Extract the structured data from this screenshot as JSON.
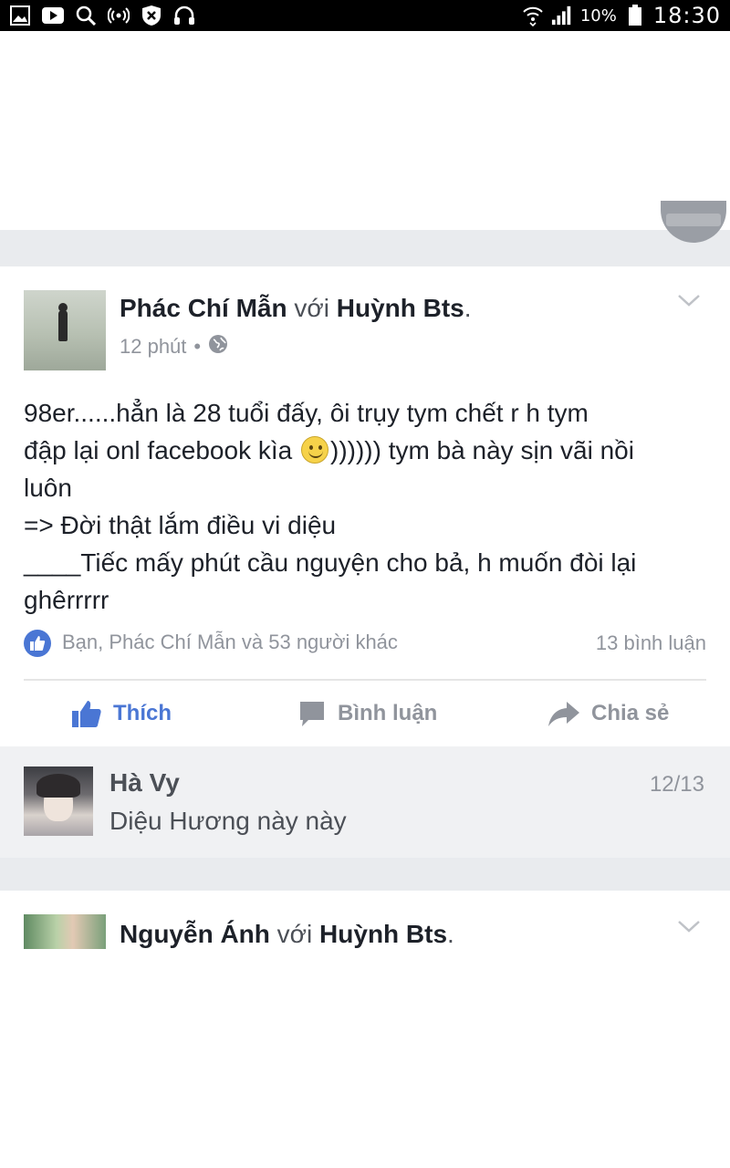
{
  "status_bar": {
    "battery_percent": "10%",
    "time": "18:30",
    "icons": [
      "gallery-icon",
      "youtube-icon",
      "search-icon",
      "hotspot-icon",
      "shield-icon",
      "headphones-icon",
      "wifi-icon",
      "signal-icon",
      "battery-icon"
    ]
  },
  "post": {
    "author": "Phác Chí Mẫn",
    "with_word": "với",
    "tagged": "Huỳnh Bts",
    "tagged_suffix": ".",
    "time": "12 phút",
    "privacy_separator": "•",
    "privacy_icon": "globe-icon",
    "body_lines": [
      "98er......hẳn là 28 tuổi đấy, ôi trụy tym chết r h tym",
      "đập lại onl facebook kìa",
      ")))))) tym bà này sịn vãi nồi",
      "luôn",
      "=> Đời thật lắm điều vi diệu",
      "____Tiếc mấy phút cầu nguyện cho bả, h muốn đòi lại",
      "ghêrrrrr"
    ],
    "reactions_text": "Bạn, Phác Chí Mẫn và 53 người khác",
    "comments_count": "13 bình luận",
    "actions": {
      "like": "Thích",
      "comment": "Bình luận",
      "share": "Chia sẻ"
    }
  },
  "comment": {
    "name": "Hà Vy",
    "text": "Diệu Hương này này",
    "date": "12/13"
  },
  "next_post": {
    "author": "Nguyễn Ánh",
    "with_word": "với",
    "tagged": "Huỳnh Bts",
    "tagged_suffix": "."
  },
  "colors": {
    "facebook_blue": "#4a76d4",
    "meta_gray": "#90949c",
    "band_gray": "#e9ebee",
    "comment_bg": "#f0f1f3"
  }
}
